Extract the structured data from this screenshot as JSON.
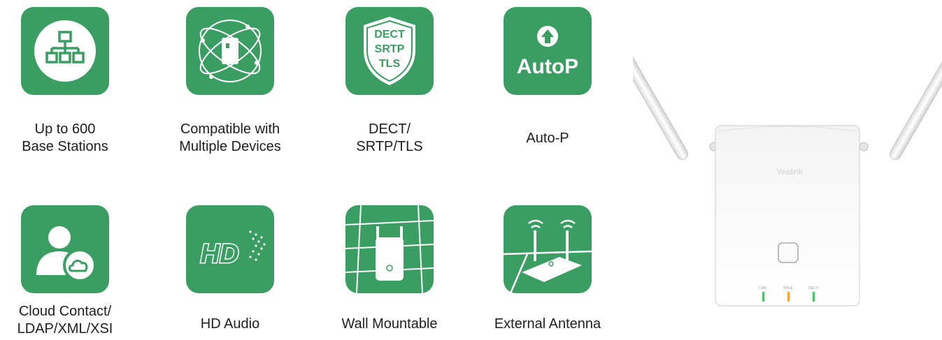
{
  "features": [
    {
      "icon": "network-tree-icon",
      "caption": [
        "Up to 600",
        "Base Stations"
      ]
    },
    {
      "icon": "multi-device-orbit-icon",
      "caption": [
        "Compatible with",
        "Multiple Devices"
      ]
    },
    {
      "icon": "security-shield-icon",
      "badge_lines": [
        "DECT",
        "SRTP",
        "TLS"
      ],
      "caption": [
        "DECT/",
        "SRTP/TLS"
      ]
    },
    {
      "icon": "autop-upload-icon",
      "badge_text": "AutoP",
      "caption": [
        "Auto-P"
      ]
    },
    {
      "icon": "cloud-contact-icon",
      "caption": [
        "Cloud Contact/",
        "LDAP/XML/XSI"
      ]
    },
    {
      "icon": "hd-audio-icon",
      "badge_text": "HD",
      "caption": [
        "HD Audio"
      ]
    },
    {
      "icon": "wall-mount-icon",
      "caption": [
        "Wall Mountable"
      ]
    },
    {
      "icon": "external-antenna-icon",
      "caption": [
        "External Antenna"
      ]
    }
  ],
  "device": {
    "brand": "Yealink",
    "leds": [
      {
        "label": "LAN",
        "color": "#4cc46c"
      },
      {
        "label": "ROLE",
        "color": "#f2a52a"
      },
      {
        "label": "DECT",
        "color": "#4cc46c"
      }
    ]
  },
  "colors": {
    "tile_green": "#3a9e62",
    "icon_white": "#ffffff"
  }
}
